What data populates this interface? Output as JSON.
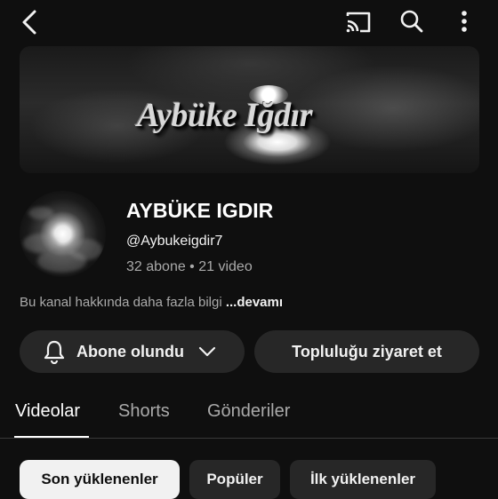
{
  "banner": {
    "text": "Aybüke Iğdır"
  },
  "channel": {
    "name": "AYBÜKE IGDIR",
    "handle": "@Aybukeigdir7",
    "stats": "32 abone  •  21 video",
    "about_text": "Bu kanal hakkında daha fazla bilgi ",
    "about_more": "...devamı"
  },
  "buttons": {
    "subscribed_label": "Abone olundu",
    "visit_community_label": "Topluluğu ziyaret et"
  },
  "tabs": [
    {
      "label": "Videolar",
      "active": true
    },
    {
      "label": "Shorts",
      "active": false
    },
    {
      "label": "Gönderiler",
      "active": false
    }
  ],
  "filters": [
    {
      "label": "Son yüklenenler",
      "selected": true
    },
    {
      "label": "Popüler",
      "selected": false
    },
    {
      "label": "İlk yüklenenler",
      "selected": false
    }
  ],
  "icons": {
    "back": "back-arrow-icon",
    "cast": "cast-icon",
    "search": "search-icon",
    "more": "more-vertical-icon",
    "bell": "bell-icon",
    "chevron": "chevron-down-icon"
  }
}
